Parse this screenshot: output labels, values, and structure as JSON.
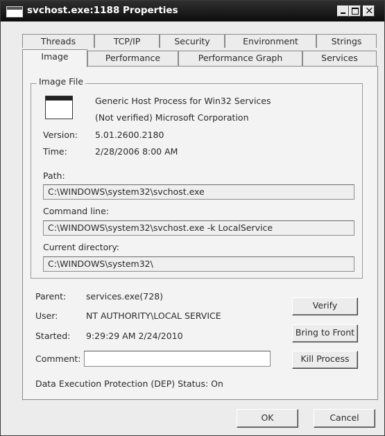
{
  "window": {
    "title": "svchost.exe:1188 Properties"
  },
  "tabs": {
    "row_back": [
      "Threads",
      "TCP/IP",
      "Security",
      "Environment",
      "Strings"
    ],
    "row_front": [
      "Image",
      "Performance",
      "Performance Graph",
      "Services"
    ],
    "selected": "Image"
  },
  "image_file": {
    "group_label": "Image File",
    "description": "Generic Host Process for Win32 Services",
    "company": "(Not verified) Microsoft Corporation",
    "version_label": "Version:",
    "version": "5.01.2600.2180",
    "time_label": "Time:",
    "time": "2/28/2006 8:00 AM",
    "path_label": "Path:",
    "path": "C:\\WINDOWS\\system32\\svchost.exe",
    "command_line_label": "Command line:",
    "command_line": "C:\\WINDOWS\\system32\\svchost.exe -k LocalService",
    "current_directory_label": "Current directory:",
    "current_directory": "C:\\WINDOWS\\system32\\"
  },
  "process": {
    "parent_label": "Parent:",
    "parent": "services.exe(728)",
    "user_label": "User:",
    "user": "NT AUTHORITY\\LOCAL SERVICE",
    "started_label": "Started:",
    "started": "9:29:29 AM  2/24/2010",
    "comment_label": "Comment:",
    "comment_value": "",
    "dep_status": "Data Execution Protection (DEP) Status:  On"
  },
  "buttons": {
    "verify": "Verify",
    "bring_to_front": "Bring to Front",
    "kill_process": "Kill Process",
    "ok": "OK",
    "cancel": "Cancel"
  },
  "icons": {
    "app": "window-icon",
    "image": "executable-window-icon"
  }
}
